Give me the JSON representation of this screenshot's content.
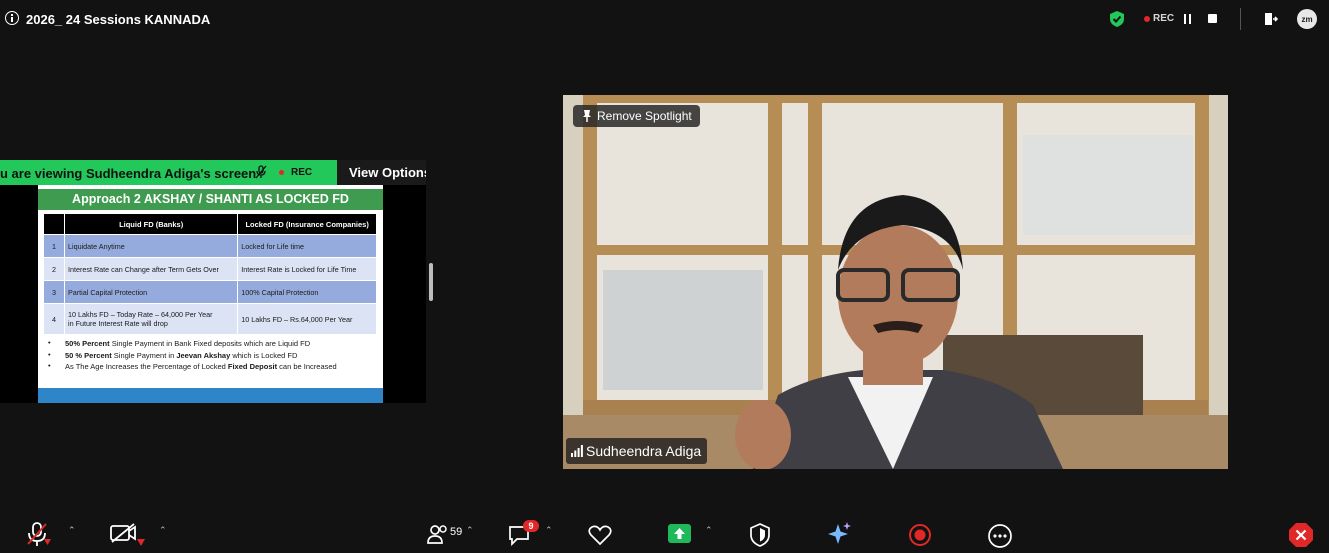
{
  "meeting": {
    "title": "2026_ 24 Sessions KANNADA",
    "rec_label": "REC"
  },
  "share": {
    "viewing_text": "u are viewing",
    "presenter": "Sudheendra Adiga's screen",
    "rec_label": "REC",
    "view_options_label": "View Options"
  },
  "slide": {
    "title": "Approach 2 AKSHAY / SHANTI AS LOCKED FD",
    "headers": [
      "",
      "Liquid FD (Banks)",
      "Locked FD (Insurance Companies)"
    ],
    "rows": [
      {
        "num": "1",
        "liquid": "Liquidate Anytime",
        "locked": "Locked for Life time"
      },
      {
        "num": "2",
        "liquid": "Interest Rate can Change after Term Gets Over",
        "locked": "Interest Rate is Locked for Life Time"
      },
      {
        "num": "3",
        "liquid": "Partial Capital Protection",
        "locked": "100% Capital Protection"
      },
      {
        "num": "4",
        "liquid_line1": "10 Lakhs FD – Today Rate – 64,000 Per Year",
        "liquid_line2": "in Future Interest Rate will drop",
        "locked": "10 Lakhs FD – Rs.64,000 Per Year"
      }
    ],
    "bullets": [
      {
        "bold": "50% Percent",
        "text": " Single Payment in Bank Fixed deposits which are Liquid FD"
      },
      {
        "bold": "50 % Percent",
        "text": " Single Payment in ",
        "bold2": "Jeevan Akshay",
        "text2": " which is Locked FD"
      },
      {
        "text": "As The Age Increases the Percentage of Locked ",
        "bold": "Fixed Deposit",
        "text2": " can be Increased"
      }
    ]
  },
  "video": {
    "spotlight_label": "Remove Spotlight",
    "participant_name": "Sudheendra Adiga"
  },
  "toolbar": {
    "participants_count": "59",
    "chat_badge": "9"
  },
  "icons": [
    "info-icon",
    "shield-check-icon",
    "pause-icon",
    "stop-icon",
    "leave-icon",
    "zoom-avatar",
    "pin-icon",
    "signal-icon",
    "mic-muted-icon",
    "video-off-icon",
    "participants-icon",
    "chat-icon",
    "heart-icon",
    "share-screen-icon",
    "security-icon",
    "ai-companion-icon",
    "record-icon",
    "more-icon",
    "end-icon"
  ],
  "colors": {
    "share_banner": "#23c85a",
    "slide_title": "#3e9b4f",
    "accent_red": "#e02828",
    "share_green": "#1fb85a"
  }
}
